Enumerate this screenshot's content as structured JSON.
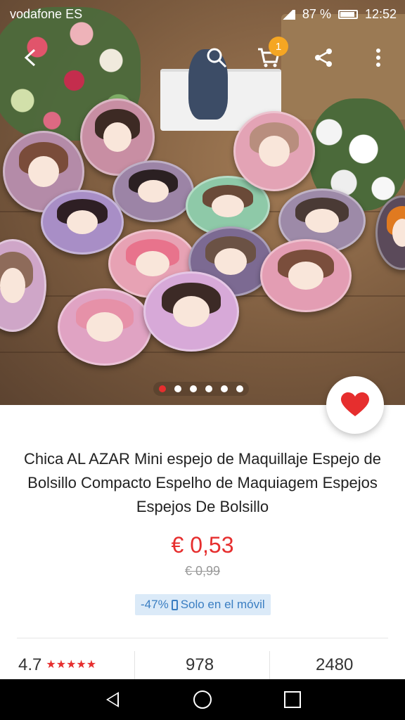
{
  "status_bar": {
    "carrier": "vodafone ES",
    "battery": "87 %",
    "time": "12:52"
  },
  "top_nav": {
    "back_icon": "arrow-left-icon",
    "search_icon": "search-icon",
    "cart_icon": "cart-icon",
    "cart_count": "1",
    "share_icon": "share-icon",
    "more_icon": "more-vert-icon"
  },
  "gallery": {
    "total_images": 6,
    "active_index": 0
  },
  "product": {
    "title": "Chica AL AZAR Mini espejo de Maquillaje Espejo de Bolsillo Compacto Espelho de Maquiagem Espejos Espejos De Bolsillo",
    "price": "€ 0,53",
    "old_price": "€ 0,99",
    "discount": "-47%",
    "mobile_only": "Solo en el móvil"
  },
  "stats": {
    "rating": "4.7",
    "stars": "★★★★★",
    "reviews": "978",
    "orders": "2480"
  },
  "colors": {
    "accent": "#e62e2e",
    "badge": "#f5a623",
    "promo_bg": "#dbeaf8",
    "promo_text": "#3a7ec2"
  }
}
